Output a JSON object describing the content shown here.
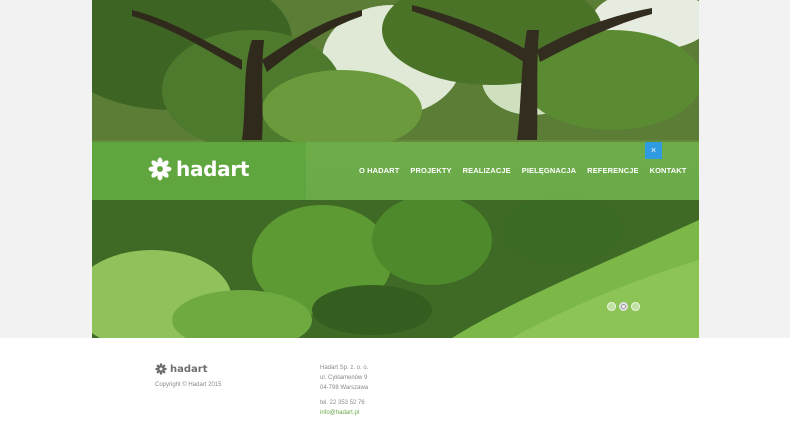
{
  "brand": {
    "name": "hadart"
  },
  "nav": {
    "items": [
      "O HADART",
      "PROJEKTY",
      "REALIZACJE",
      "PIELĘGNACJA",
      "REFERENCJE",
      "KONTAKT"
    ],
    "close_label": "×"
  },
  "slider": {
    "dots": 3,
    "active_index": 1
  },
  "footer": {
    "logo_text": "hadart",
    "copyright": "Copyright © Hadart 2015",
    "address": [
      "Hadart Sp. z. o. o.",
      "ul. Cyklamenów 9",
      "04-798 Warszawa"
    ],
    "phone": "tel. 22 353 52 76",
    "email": "info@hadart.pl"
  },
  "colors": {
    "nav_green": "#6eaf4b",
    "logo_green": "#60a53e",
    "close_blue": "#2f9be0",
    "link_green": "#6aa84f"
  },
  "icons": {
    "logo": "flower-icon",
    "close": "close-icon"
  }
}
